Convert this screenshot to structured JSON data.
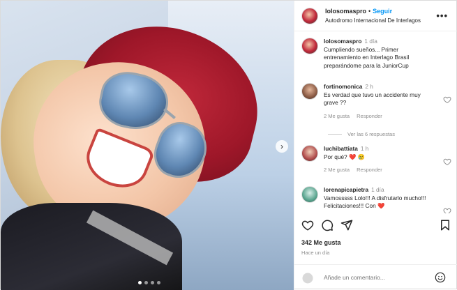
{
  "post": {
    "image_dots": 4,
    "active_dot": 1
  },
  "header": {
    "username": "lolosomaspro",
    "separator": "•",
    "follow_label": "Seguir",
    "location": "Autodromo Internacional De Interlagos",
    "more_icon": "more-horizontal-icon"
  },
  "caption": {
    "username": "lolosomaspro",
    "time": "1 día",
    "text": "Cumpliendo sueños... Primer entrenamiento en Interlago Brasil preparándome para la JuniorCup"
  },
  "comments": [
    {
      "username": "fortinomonica",
      "time": "2 h",
      "text": "Es verdad que tuvo un accidente muy grave ??",
      "likes": "2 Me gusta",
      "reply": "Responder",
      "view_replies": "Ver las 6 respuestas"
    },
    {
      "username": "luchibattiata",
      "time": "1 h",
      "text": "Por qué?",
      "emoji": "❤️ 😢",
      "likes": "2 Me gusta",
      "reply": "Responder"
    },
    {
      "username": "lorenapicapietra",
      "time": "1 día",
      "text": "Vamosssss Lolo!!! A disfrutarlo mucho!!! Felicitaciones!!! Con",
      "emoji": "❤️"
    }
  ],
  "actions": {
    "like_icon": "heart-icon",
    "comment_icon": "comment-icon",
    "share_icon": "send-icon",
    "save_icon": "bookmark-icon"
  },
  "likes_count": "342 Me gusta",
  "posted_ago": "Hace un día",
  "add_comment": {
    "placeholder": "Añade un comentario..."
  },
  "colors": {
    "follow_blue": "#0095f6",
    "muted": "#8e8e8e",
    "text": "#262626",
    "like_red": "#ed1c24"
  }
}
